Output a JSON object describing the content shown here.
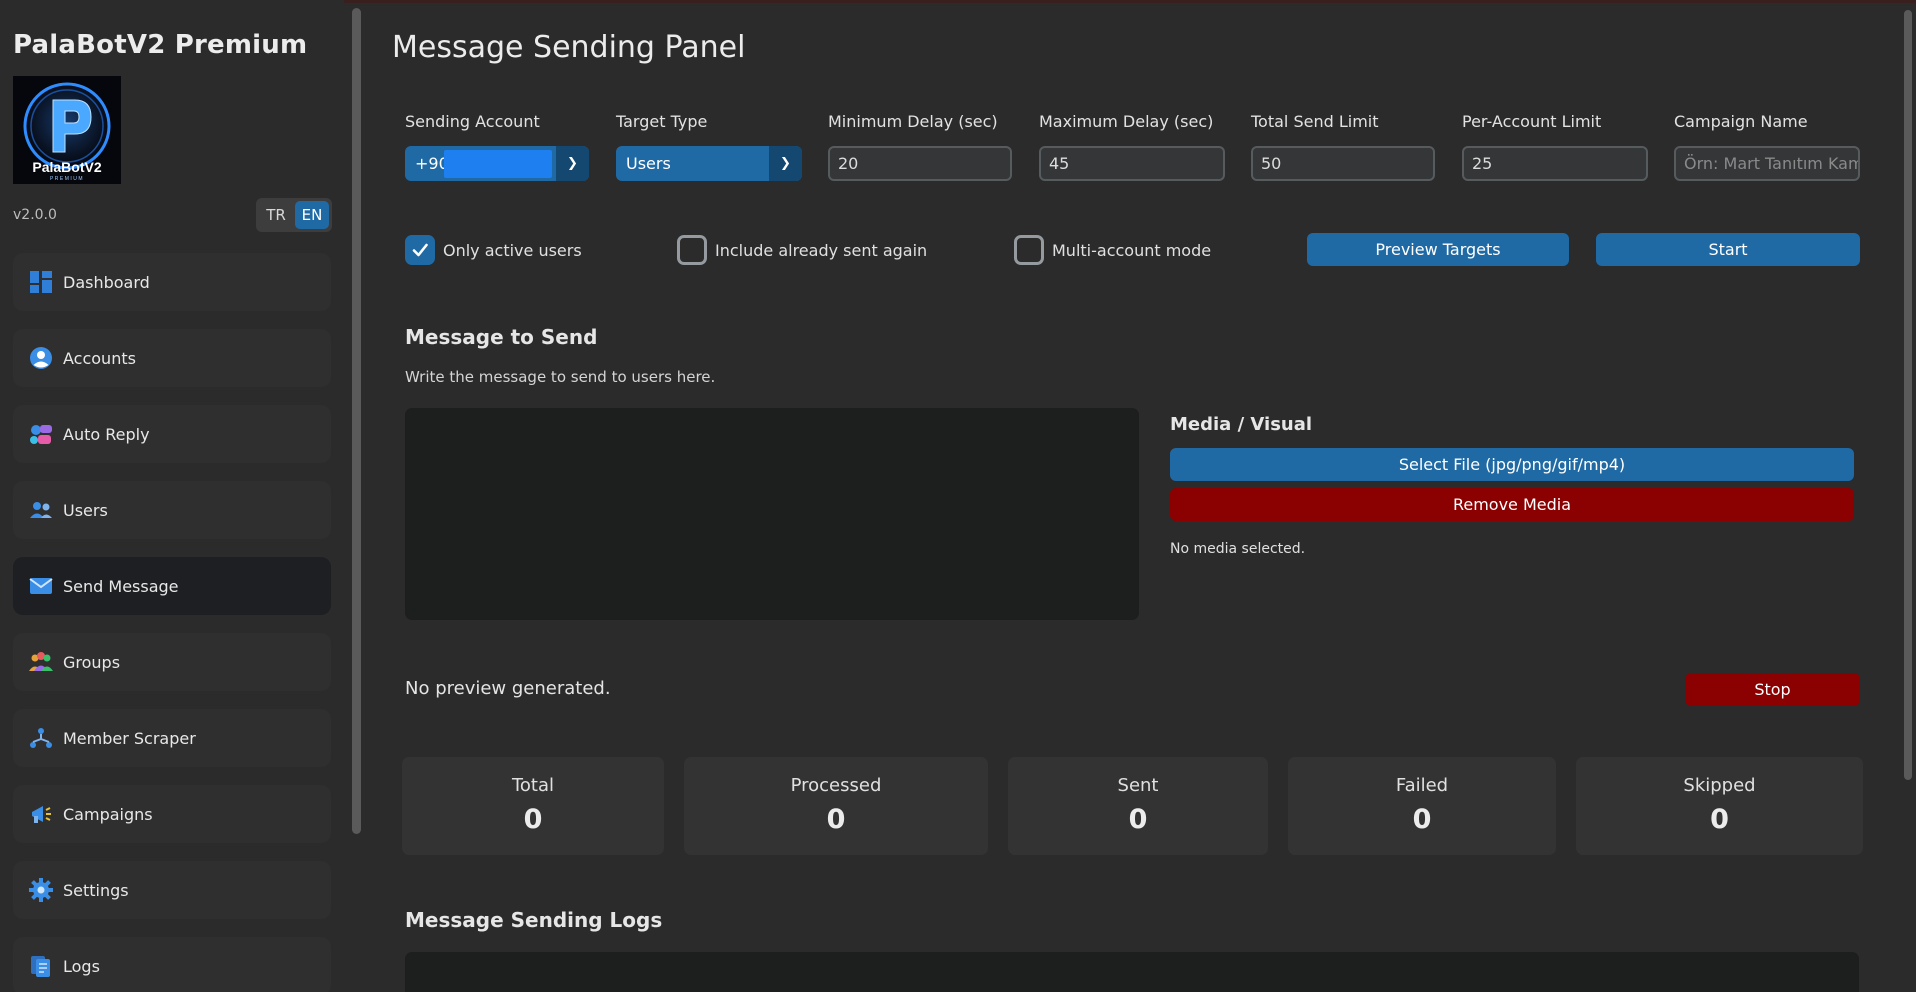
{
  "app": {
    "title": "PalaBotV2 Premium",
    "version": "v2.0.0",
    "logo_letter": "P",
    "logo_text": "PalaBotV2",
    "logo_sub": "PREMIUM",
    "languages": [
      "TR",
      "EN"
    ],
    "active_language": "EN"
  },
  "sidebar": {
    "items": [
      {
        "label": "Dashboard",
        "icon": "dashboard-icon"
      },
      {
        "label": "Accounts",
        "icon": "user-circle-icon"
      },
      {
        "label": "Auto Reply",
        "icon": "chat-bubbles-icon"
      },
      {
        "label": "Users",
        "icon": "users-icon"
      },
      {
        "label": "Send Message",
        "icon": "envelope-icon",
        "active": true
      },
      {
        "label": "Groups",
        "icon": "group-icon"
      },
      {
        "label": "Member Scraper",
        "icon": "network-icon"
      },
      {
        "label": "Campaigns",
        "icon": "megaphone-icon"
      },
      {
        "label": "Settings",
        "icon": "gear-icon"
      },
      {
        "label": "Logs",
        "icon": "document-icon"
      }
    ]
  },
  "panel": {
    "title": "Message Sending Panel",
    "fields": {
      "sending_account": {
        "label": "Sending Account",
        "value": "+90"
      },
      "target_type": {
        "label": "Target Type",
        "value": "Users"
      },
      "min_delay": {
        "label": "Minimum Delay (sec)",
        "value": "20"
      },
      "max_delay": {
        "label": "Maximum Delay (sec)",
        "value": "45"
      },
      "total_limit": {
        "label": "Total Send Limit",
        "value": "50"
      },
      "per_account_limit": {
        "label": "Per-Account Limit",
        "value": "25"
      },
      "campaign_name": {
        "label": "Campaign Name",
        "value": "",
        "placeholder": "Örn: Mart Tanıtım Kamp"
      }
    },
    "options": {
      "only_active": {
        "label": "Only active users",
        "checked": true
      },
      "include_sent": {
        "label": "Include already sent again",
        "checked": false
      },
      "multi_account": {
        "label": "Multi-account mode",
        "checked": false
      }
    },
    "buttons": {
      "preview": "Preview Targets",
      "start": "Start",
      "select_file": "Select File (jpg/png/gif/mp4)",
      "remove_media": "Remove Media",
      "stop": "Stop"
    },
    "message": {
      "title": "Message to Send",
      "subtitle": "Write the message to send to users here.",
      "value": ""
    },
    "media": {
      "title": "Media / Visual",
      "status": "No media selected."
    },
    "preview_status": "No preview generated.",
    "stats": [
      {
        "label": "Total",
        "value": "0"
      },
      {
        "label": "Processed",
        "value": "0"
      },
      {
        "label": "Sent",
        "value": "0"
      },
      {
        "label": "Failed",
        "value": "0"
      },
      {
        "label": "Skipped",
        "value": "0"
      }
    ],
    "logs_title": "Message Sending Logs"
  },
  "colors": {
    "background": "#2b2b2b",
    "accent": "#1f6aa5",
    "danger": "#8b0000",
    "input_bg": "#343638",
    "card_bg": "#333333"
  }
}
